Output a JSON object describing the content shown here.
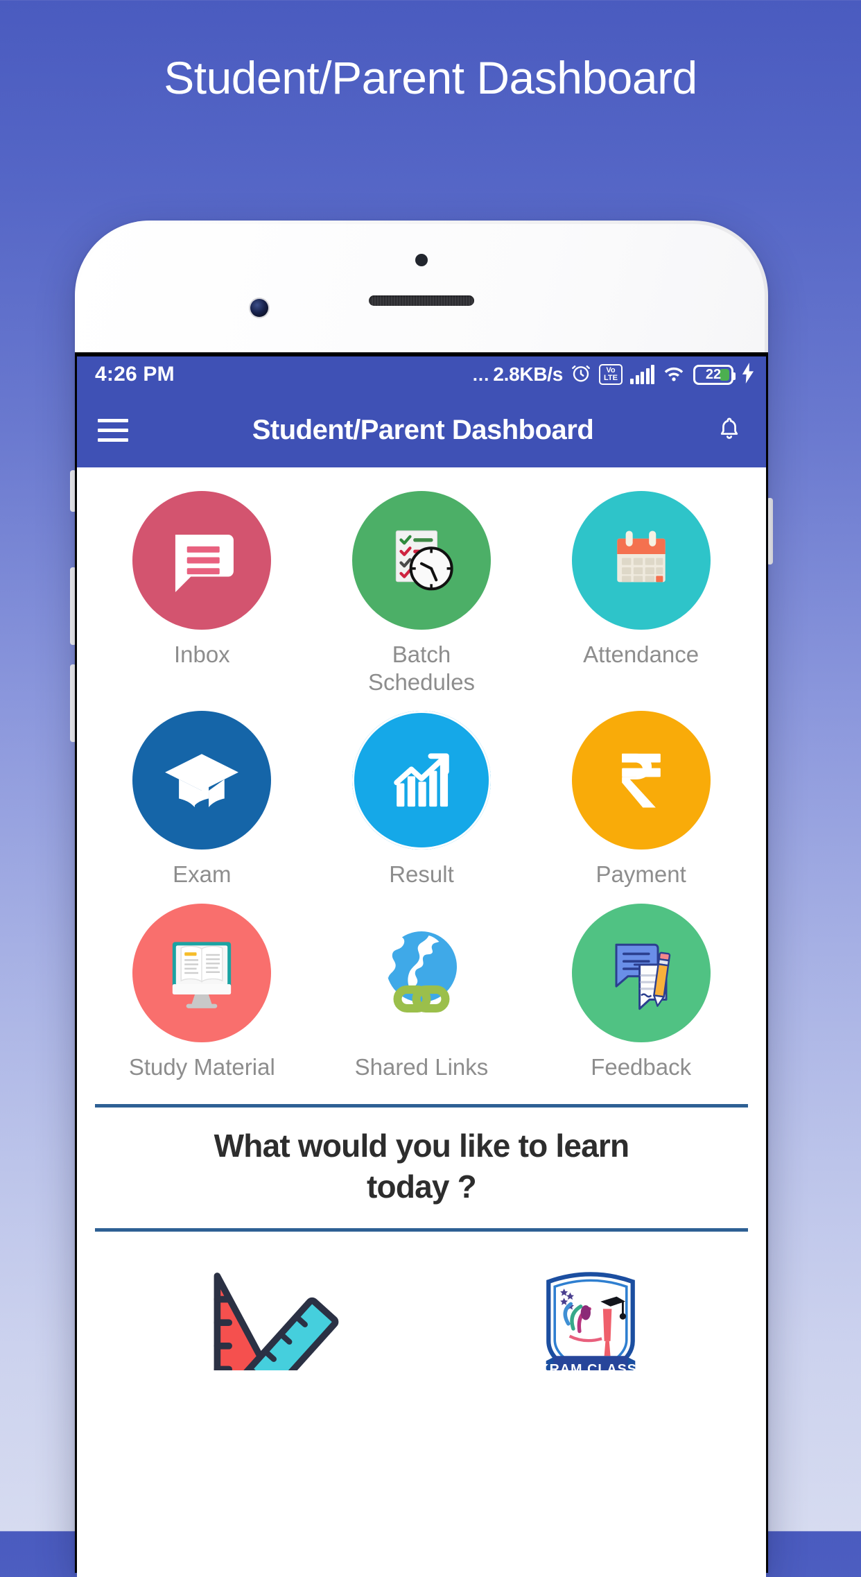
{
  "page": {
    "heading": "Student/Parent Dashboard",
    "background_top_color": "#4a5bbf",
    "background_bottom_color": "#d6dbf0"
  },
  "status_bar": {
    "time": "4:26 PM",
    "network_speed_dots": "...",
    "network_speed": "2.8KB/s",
    "alarm_icon": "alarm-clock-icon",
    "volte_line1": "Vo",
    "volte_line2": "LTE",
    "signal_icon": "cellular-signal-icon",
    "wifi_icon": "wifi-icon",
    "battery_level": "22",
    "charging_icon": "charging-bolt-icon",
    "background_color": "#3f51b5"
  },
  "app_bar": {
    "menu_icon": "hamburger-menu-icon",
    "title": "Student/Parent Dashboard",
    "notification_icon": "bell-icon",
    "background_color": "#3f51b5"
  },
  "grid": {
    "tiles": [
      {
        "label": "Inbox",
        "icon": "message-bubble-icon",
        "color": "#d3546f"
      },
      {
        "label": "Batch\nSchedules",
        "icon": "checklist-clock-icon",
        "color": "#4caf67"
      },
      {
        "label": "Attendance",
        "icon": "calendar-icon",
        "color": "#2ec4c9"
      },
      {
        "label": "Exam",
        "icon": "graduation-cap-icon",
        "color": "#1565a8"
      },
      {
        "label": "Result",
        "icon": "growth-chart-icon",
        "color": "#15a8e8"
      },
      {
        "label": "Payment",
        "icon": "rupee-icon",
        "color": "#f9ab09"
      },
      {
        "label": "Study Material",
        "icon": "book-monitor-icon",
        "color": "#f96f6d"
      },
      {
        "label": "Shared Links",
        "icon": "globe-link-icon",
        "color": "#3fa9e8"
      },
      {
        "label": "Feedback",
        "icon": "chat-pencil-icon",
        "color": "#50c283"
      }
    ]
  },
  "prompt": {
    "line1": "What would you like to learn",
    "line2": "today ?",
    "rule_color": "#2e6094"
  },
  "promo": {
    "items": [
      {
        "icon": "ruler-set-square-icon",
        "label": ""
      },
      {
        "icon": "vikram-classes-logo",
        "label": "VIKRAM CLASSES"
      }
    ]
  }
}
